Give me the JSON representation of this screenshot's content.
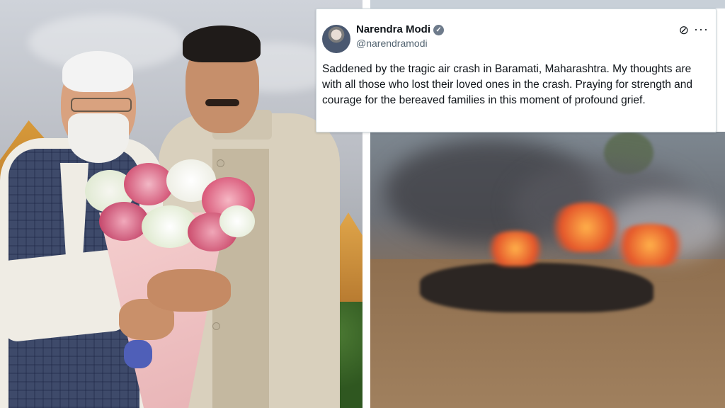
{
  "tweet": {
    "name": "Narendra Modi",
    "verified_badge": "✓",
    "handle": "@narendramodi",
    "x_icon": "⊘",
    "more_icon": "···",
    "text": "Saddened by the tragic air crash in Baramati, Maharashtra. My thoughts are with all those who lost their loved ones in the crash. Praying for strength and courage for the bereaved families in this moment of profound grief."
  },
  "icons": [
    "verified-badge-icon",
    "x-logo-icon",
    "more-options-icon",
    "avatar"
  ]
}
